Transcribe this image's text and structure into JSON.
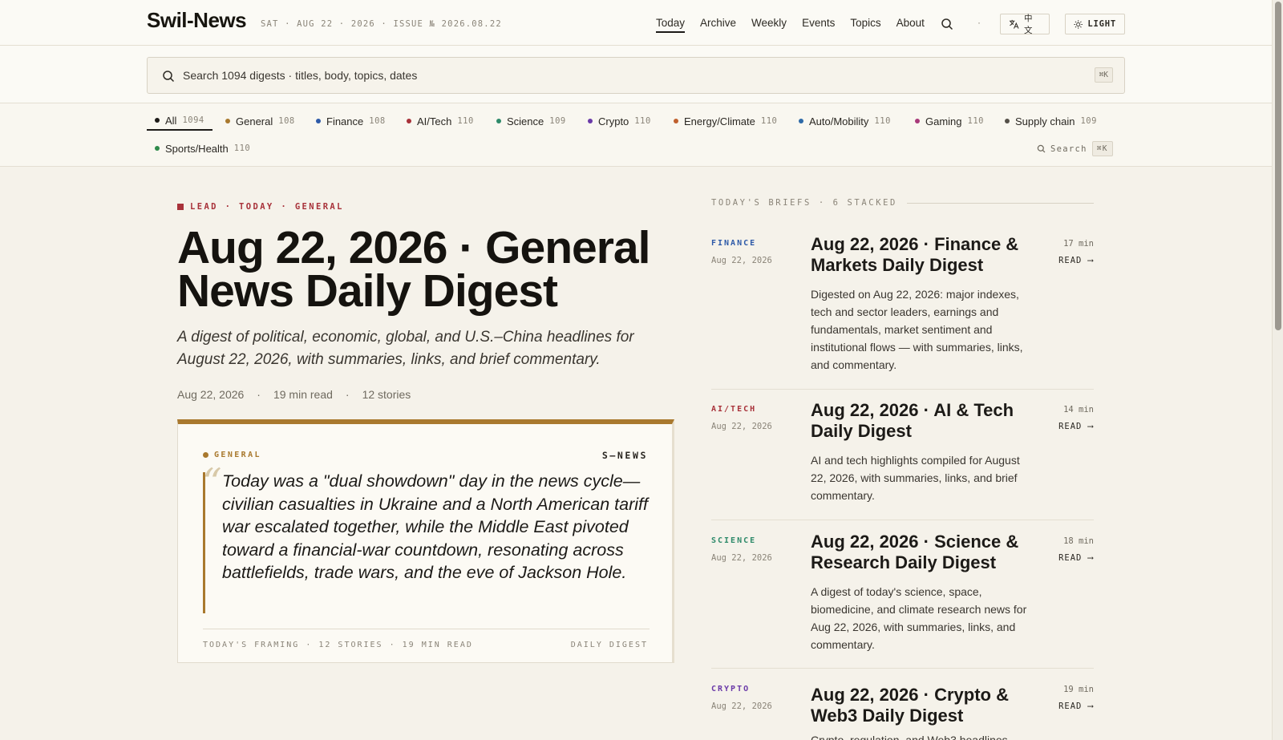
{
  "header": {
    "logo": "Swil-News",
    "issue": "SAT · AUG 22 · 2026 · ISSUE № 2026.08.22",
    "nav": [
      "Today",
      "Archive",
      "Weekly",
      "Events",
      "Topics",
      "About"
    ],
    "nav_dot": "·",
    "lang_label": "中文",
    "theme_label": "LIGHT"
  },
  "search": {
    "text": "Search 1094 digests · titles, body, topics, dates",
    "shortcut": "⌘K"
  },
  "categories": [
    {
      "label": "All",
      "count": "1094",
      "color": "#1c1a17"
    },
    {
      "label": "General",
      "count": "108",
      "color": "#a9792e"
    },
    {
      "label": "Finance",
      "count": "108",
      "color": "#2e5aa8"
    },
    {
      "label": "AI/Tech",
      "count": "110",
      "color": "#a8323a"
    },
    {
      "label": "Science",
      "count": "109",
      "color": "#2e8a6a"
    },
    {
      "label": "Crypto",
      "count": "110",
      "color": "#6a3aa8"
    },
    {
      "label": "Energy/Climate",
      "count": "110",
      "color": "#c0602e"
    },
    {
      "label": "Auto/Mobility",
      "count": "110",
      "color": "#2e6aa8"
    },
    {
      "label": "Gaming",
      "count": "110",
      "color": "#a83a7a"
    },
    {
      "label": "Supply chain",
      "count": "109",
      "color": "#555049"
    },
    {
      "label": "Sports/Health",
      "count": "110",
      "color": "#2e8a4a"
    }
  ],
  "cat_search": {
    "label": "Search",
    "shortcut": "⌘K"
  },
  "lead": {
    "label": "LEAD · TODAY · GENERAL",
    "title": "Aug 22, 2026 · General News Daily Digest",
    "subtitle": "A digest of political, economic, global, and U.S.–China headlines for August 22, 2026, with summaries, links, and brief commentary.",
    "meta_date": "Aug 22, 2026",
    "meta_read": "19 min read",
    "meta_stories": "12 stories",
    "meta_sep": "·",
    "card": {
      "tag": "GENERAL",
      "brand": "S—NEWS",
      "quote_mark": "“",
      "quote": "Today was a \"dual showdown\" day in the news cycle—civilian casualties in Ukraine and a North American tariff war escalated together, while the Middle East pivoted toward a financial-war countdown, resonating across battlefields, trade wars, and the eve of Jackson Hole.",
      "foot_left": "TODAY'S FRAMING · 12 STORIES · 19 MIN READ",
      "foot_right": "DAILY DIGEST"
    }
  },
  "briefs": {
    "heading": "TODAY'S BRIEFS · 6 STACKED",
    "items": [
      {
        "tag": "FINANCE",
        "color": "#2e5aa8",
        "date": "Aug 22, 2026",
        "title": "Aug 22, 2026 · Finance & Markets Daily Digest",
        "desc": "Digested on Aug 22, 2026: major indexes, tech and sector leaders, earnings and fundamentals, market sentiment and institutional flows — with summaries, links, and commentary.",
        "min": "17 min",
        "read": "READ ⟶"
      },
      {
        "tag": "AI/TECH",
        "color": "#a8323a",
        "date": "Aug 22, 2026",
        "title": "Aug 22, 2026 · AI & Tech Daily Digest",
        "desc": "AI and tech highlights compiled for August 22, 2026, with summaries, links, and brief commentary.",
        "min": "14 min",
        "read": "READ ⟶"
      },
      {
        "tag": "SCIENCE",
        "color": "#2e8a6a",
        "date": "Aug 22, 2026",
        "title": "Aug 22, 2026 · Science & Research Daily Digest",
        "desc": "A digest of today's science, space, biomedicine, and climate research news for Aug 22, 2026, with summaries, links, and commentary.",
        "min": "18 min",
        "read": "READ ⟶"
      },
      {
        "tag": "CRYPTO",
        "color": "#6a3aa8",
        "date": "Aug 22, 2026",
        "title": "Aug 22, 2026 · Crypto & Web3 Daily Digest",
        "desc": "Crypto, regulation, and Web3 headlines",
        "min": "19 min",
        "read": "READ ⟶"
      }
    ]
  }
}
